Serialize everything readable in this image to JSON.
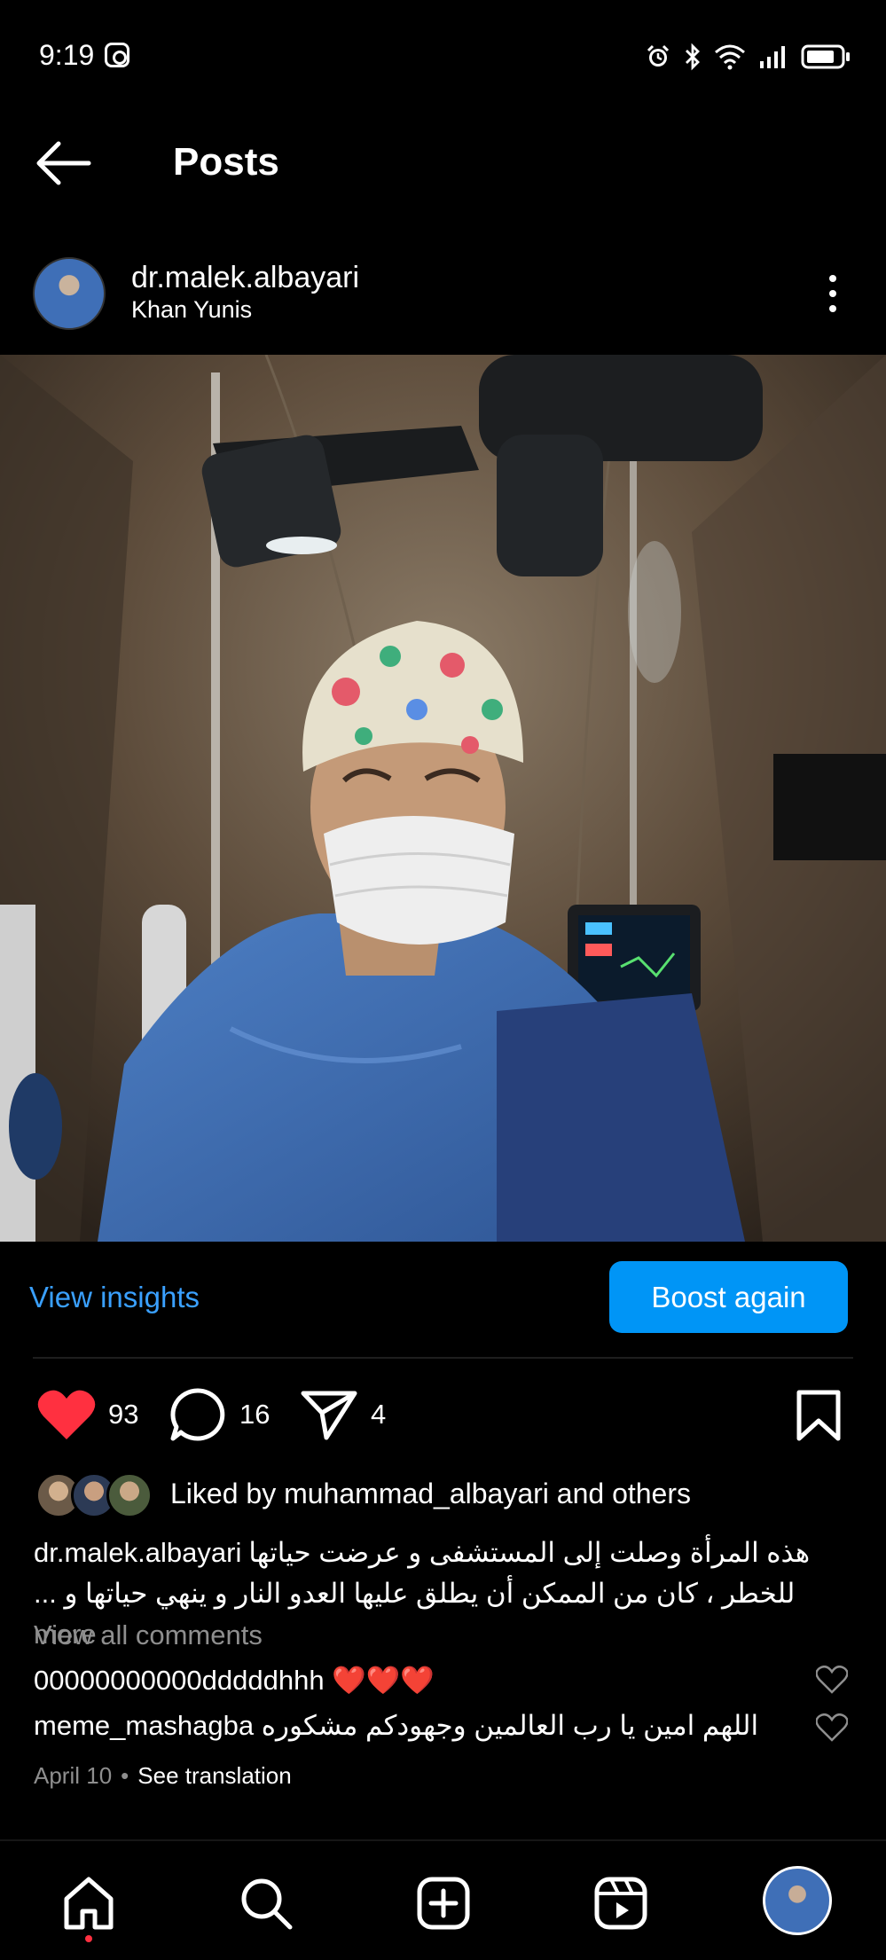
{
  "status_bar": {
    "time": "9:19"
  },
  "header": {
    "title": "Posts"
  },
  "post": {
    "author": "dr.malek.albayari",
    "location": "Khan Yunis",
    "actions": {
      "likes": "93",
      "comments": "16",
      "shares": "4"
    },
    "liked_by": {
      "prefix": "Liked by ",
      "user": "muhammad_albayari",
      "suffix": " and others"
    },
    "caption": {
      "user": "dr.malek.albayari",
      "line1": "هذه المرأة وصلت إلى المستشفى و عرضت حياتها",
      "line2": "للخطر ، كان من الممكن أن يطلق عليها العدو النار و ينهي حياتها و ...",
      "more": "more"
    },
    "view_all_comments": "View all comments",
    "comments": [
      {
        "user": "00000000000dddddhhh",
        "text": "❤️❤️❤️"
      },
      {
        "user": "meme_mashagba",
        "text": "اللهم امين يا رب العالمين وجهودكم مشكوره"
      }
    ],
    "date": "April 10",
    "separator": "•",
    "see_translation": "See translation"
  },
  "insights": {
    "view_label": "View insights",
    "boost_label": "Boost again"
  },
  "colors": {
    "accent": "#0095f6",
    "link": "#3aa0ff",
    "like": "#ff3040",
    "muted": "#8e8e8e"
  }
}
